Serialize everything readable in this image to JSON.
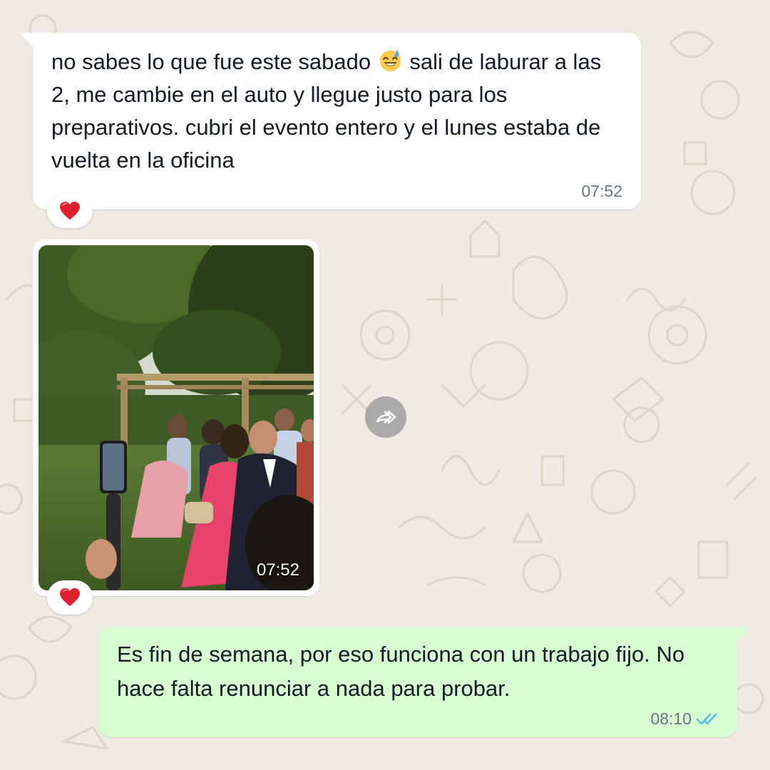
{
  "messages": {
    "incoming_text": {
      "before_emoji": "no sabes lo que fue este sabado",
      "emoji": "grinning-sweat-emoji",
      "after_emoji": " sali de laburar a las 2, me cambie en el auto y llegue justo para los preparativos. cubri el evento entero y el lunes estaba de vuelta en la oficina",
      "time": "07:52",
      "reaction": "❤️"
    },
    "incoming_video": {
      "time": "07:52",
      "reaction": "❤️",
      "forward_icon": "forward-icon"
    },
    "outgoing_text": {
      "text": "Es fin de semana, por eso funciona con un trabajo fijo. No hace falta renunciar a nada para probar.",
      "time": "08:10",
      "status_icon": "double-check-read-icon"
    }
  },
  "colors": {
    "wallpaper": "#efeae2",
    "incoming_bubble": "#ffffff",
    "outgoing_bubble": "#d9fdd3",
    "read_ticks": "#53bdeb",
    "timestamp": "#667781",
    "reaction_heart": "#e0212d"
  }
}
